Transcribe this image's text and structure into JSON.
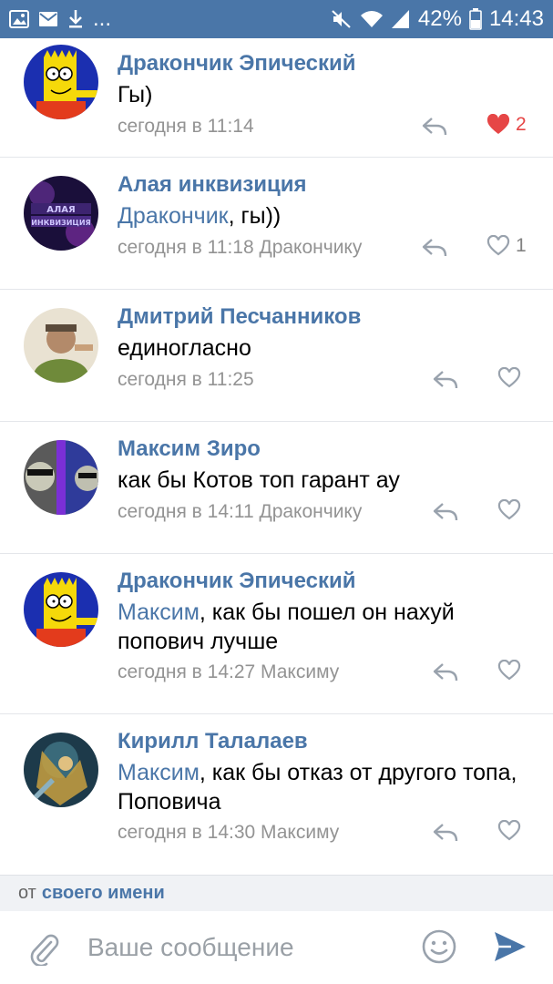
{
  "status_bar": {
    "battery": "42%",
    "time": "14:43",
    "left_icons": [
      "image-icon",
      "mail-icon",
      "download-icon",
      "more-dots-icon"
    ],
    "more_dots": "..."
  },
  "comments": [
    {
      "author": "Дракончик Эпический",
      "mention": "",
      "text": "Гы)",
      "meta": "сегодня в 11:14",
      "likes": "2",
      "liked": true
    },
    {
      "author": "Алая инквизиция",
      "mention": "Дракончик",
      "text": ", гы))",
      "meta": "сегодня в 11:18 Дракончику",
      "likes": "1",
      "liked": false
    },
    {
      "author": "Дмитрий Песчанников",
      "mention": "",
      "text": "единогласно",
      "meta": "сегодня в 11:25",
      "likes": "",
      "liked": false
    },
    {
      "author": "Максим Зиро",
      "mention": "",
      "text": "как бы Котов топ гарант ау",
      "meta": "сегодня в 14:11 Дракончику",
      "likes": "",
      "liked": false
    },
    {
      "author": "Дракончик Эпический",
      "mention": "Максим",
      "text": ", как бы пошел он нахуй попович лучше",
      "meta": "сегодня в 14:27 Максиму",
      "likes": "",
      "liked": false
    },
    {
      "author": "Кирилл Талалаев",
      "mention": "Максим",
      "text": ", как бы отказ от другого топа, Поповича",
      "meta": "сегодня в 14:30 Максиму",
      "likes": "",
      "liked": false
    }
  ],
  "sender": {
    "prefix": "от",
    "link": "своего имени"
  },
  "composer": {
    "placeholder": "Ваше сообщение"
  },
  "colors": {
    "accent": "#4a76a8",
    "like_active": "#e64646",
    "meta": "#939393"
  }
}
